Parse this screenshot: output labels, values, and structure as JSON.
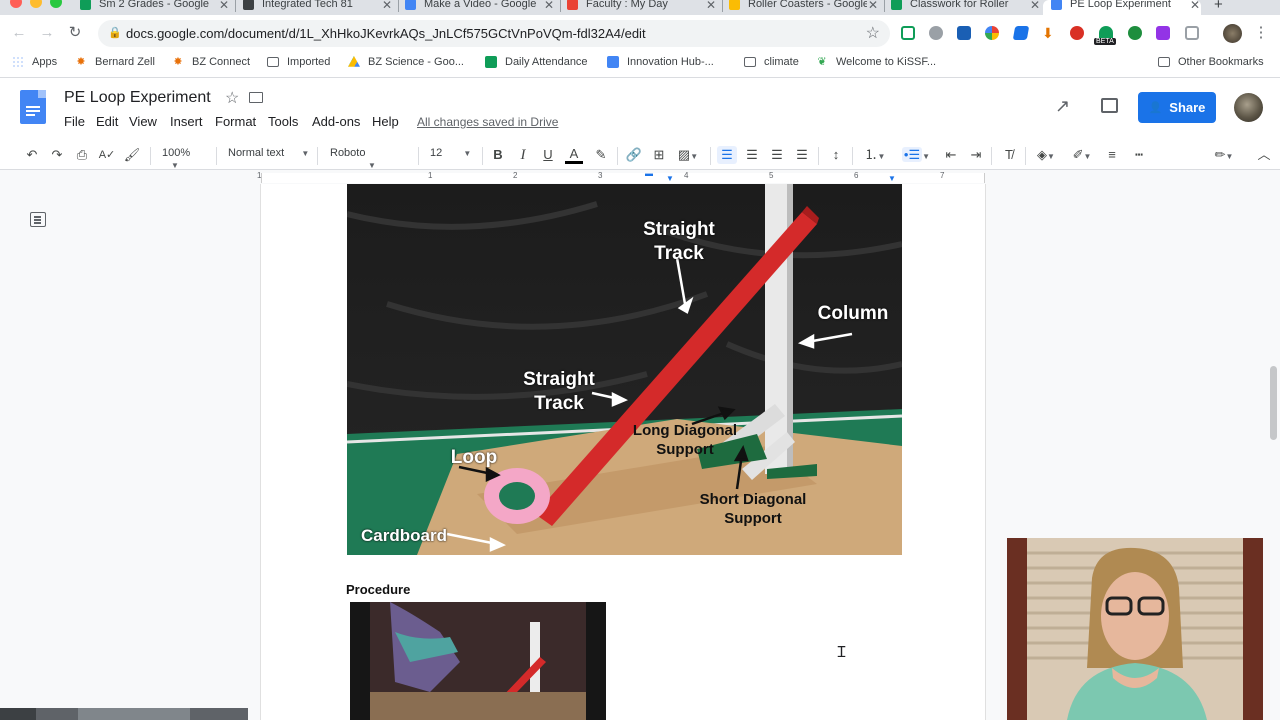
{
  "browser": {
    "tabs": [
      {
        "title": "Sm 2 Grades - Google",
        "icon_color": "#0f9d58"
      },
      {
        "title": "Integrated Tech 81",
        "icon_color": "#3c4043"
      },
      {
        "title": "Make a Video - Google",
        "icon_color": "#4285f4"
      },
      {
        "title": "Faculty : My Day",
        "icon_color": "#ea4335"
      },
      {
        "title": "Roller Coasters - Google",
        "icon_color": "#fbbc04"
      },
      {
        "title": "Classwork for Roller",
        "icon_color": "#0f9d58"
      },
      {
        "title": "PE Loop Experiment",
        "icon_color": "#4285f4",
        "active": true
      }
    ],
    "new_tab_label": "+",
    "close_label": "✕",
    "url": "docs.google.com/document/d/1L_XhHkoJKevrkAQs_JnLCf575GCtVnPoVQm-fdl32A4/edit",
    "beta_label": "BETA"
  },
  "bookmarks": [
    {
      "label": "Apps",
      "icon": "apps-grid-icon"
    },
    {
      "label": "Bernard Zell",
      "icon": "maple-leaf-icon"
    },
    {
      "label": "BZ Connect",
      "icon": "maple-leaf-icon"
    },
    {
      "label": "Imported",
      "icon": "folder-icon"
    },
    {
      "label": "BZ Science - Goo...",
      "icon": "drive-icon"
    },
    {
      "label": "Daily Attendance",
      "icon": "sheets-icon"
    },
    {
      "label": "Innovation Hub-...",
      "icon": "docs-icon"
    },
    {
      "label": "climate",
      "icon": "folder-icon"
    },
    {
      "label": "Welcome to KiSSF...",
      "icon": "leaf-icon"
    },
    {
      "label": "Other Bookmarks",
      "icon": "folder-icon"
    }
  ],
  "docs": {
    "title": "PE Loop Experiment",
    "menu": [
      "File",
      "Edit",
      "View",
      "Insert",
      "Format",
      "Tools",
      "Add-ons",
      "Help"
    ],
    "saved_status": "All changes saved in Drive",
    "share_label": "Share",
    "colors": {
      "accent": "#1a73e8"
    }
  },
  "format_toolbar": {
    "zoom": "100%",
    "style": "Normal text",
    "font": "Roboto",
    "size": "12"
  },
  "ruler": {
    "numbers": [
      "1",
      "1",
      "2",
      "3",
      "4",
      "5",
      "6",
      "7"
    ]
  },
  "image_labels": {
    "straight_track_1": "Straight\nTrack",
    "column": "Column",
    "straight_track_2": "Straight\nTrack",
    "long_diagonal": "Long Diagonal\nSupport",
    "loop": "Loop",
    "short_diagonal": "Short Diagonal\nSupport",
    "cardboard": "Cardboard"
  },
  "procedure_heading": "Procedure"
}
